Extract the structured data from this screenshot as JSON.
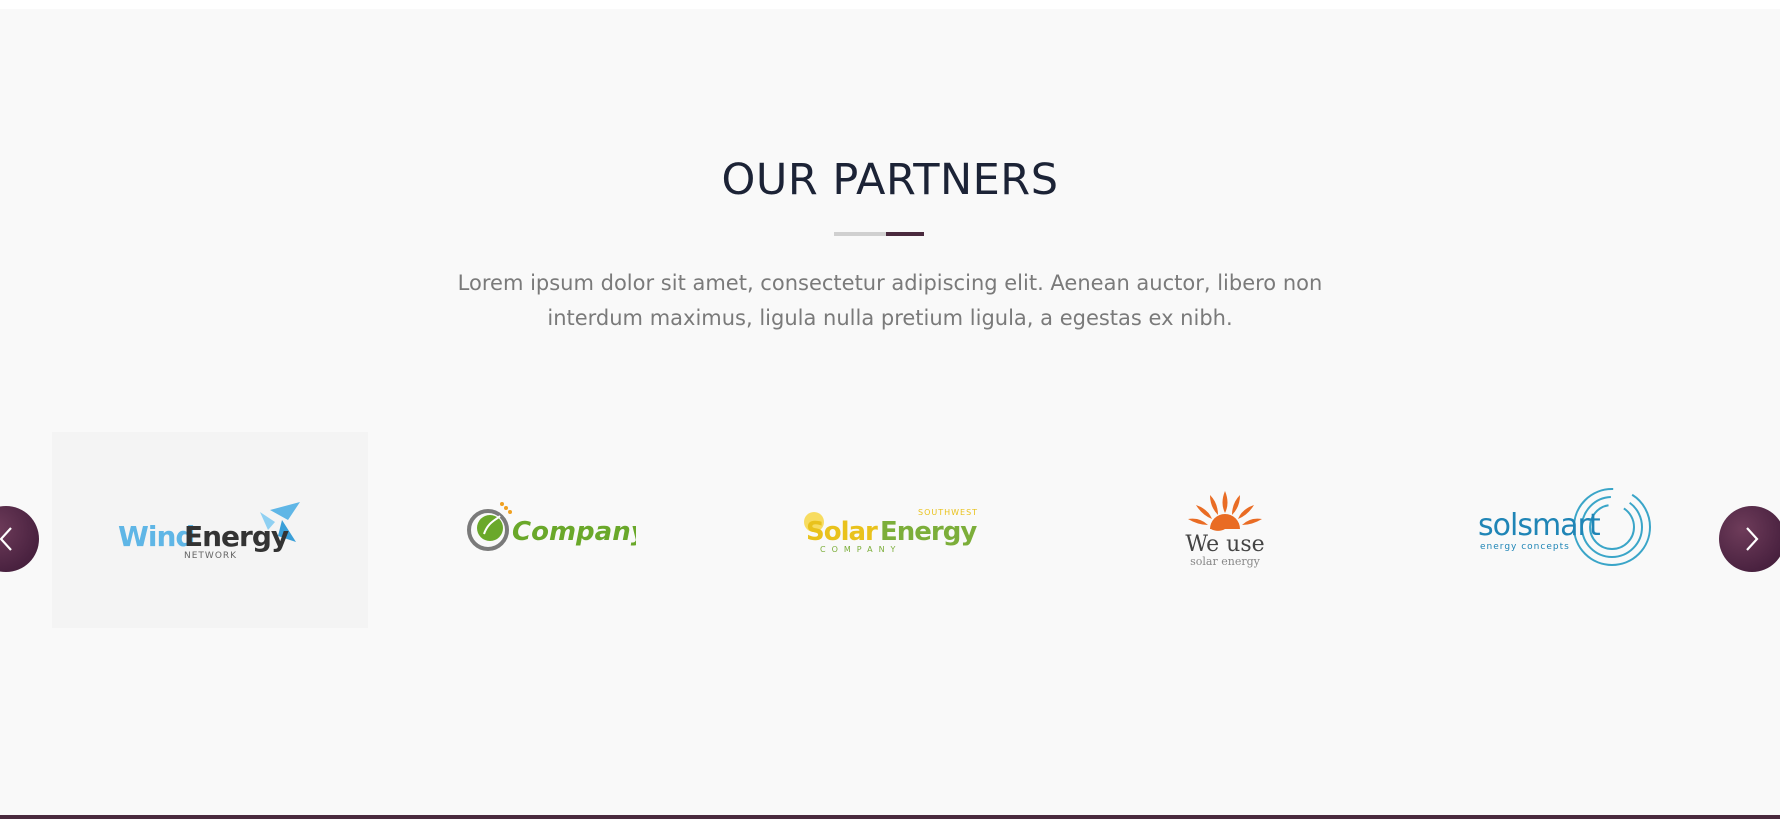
{
  "section": {
    "title": "OUR PARTNERS",
    "description": "Lorem ipsum dolor sit amet, consectetur adipiscing elit. Aenean auctor, libero non interdum maximus, ligula nulla pretium ligula, a egestas ex nibh."
  },
  "colors": {
    "background": "#f9f9f9",
    "title": "#1c2336",
    "text": "#7a7a7a",
    "accent": "#4a2a3e",
    "divider_grey": "#d0d0d0"
  },
  "carousel": {
    "prev_icon": "chevron-left-icon",
    "next_icon": "chevron-right-icon",
    "logos": [
      {
        "name": "windenergy-logo",
        "word1": "Wind",
        "word2": "Energy",
        "tagline": "NETWORK"
      },
      {
        "name": "company-logo",
        "word1": "Company"
      },
      {
        "name": "solarenergy-logo",
        "word1": "Solar",
        "word2": "Energy",
        "tagline_top": "SOUTHWEST",
        "tagline": "COMPANY"
      },
      {
        "name": "weuse-logo",
        "word1": "We use",
        "tagline": "solar energy"
      },
      {
        "name": "solsmart-logo",
        "word1": "solsmart",
        "tagline": "energy concepts"
      }
    ]
  }
}
